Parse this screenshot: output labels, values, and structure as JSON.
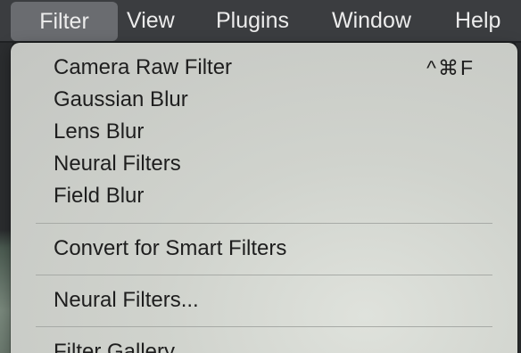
{
  "menubar": {
    "items": [
      {
        "label": "Filter",
        "active": true
      },
      {
        "label": "View"
      },
      {
        "label": "Plugins"
      },
      {
        "label": "Window"
      },
      {
        "label": "Help"
      }
    ]
  },
  "filter_menu": {
    "items": [
      {
        "label": "Camera Raw Filter",
        "shortcut": "^⌘F"
      },
      {
        "label": "Gaussian Blur"
      },
      {
        "label": "Lens Blur"
      },
      {
        "label": "Neural Filters"
      },
      {
        "label": "Field Blur"
      },
      {
        "label": "Convert for Smart Filters"
      },
      {
        "label": "Neural Filters..."
      },
      {
        "label": "Filter Gallery..."
      }
    ]
  },
  "colors": {
    "menubar_bg": "#3b3d40",
    "active_bg": "#6a6c70",
    "menu_bg": "#d0d3cd",
    "menu_text": "#1e1e1e"
  }
}
